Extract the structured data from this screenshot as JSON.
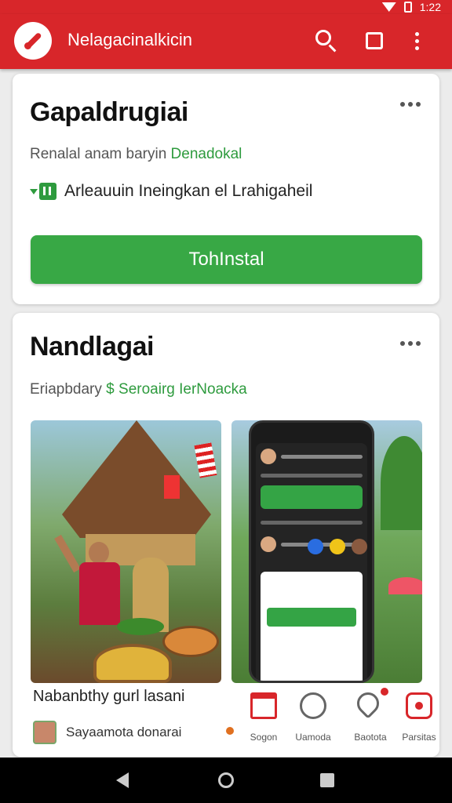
{
  "status_bar": {
    "time": "1:22"
  },
  "app_bar": {
    "title": "Nelagacinalkicin",
    "icons": [
      "app-logo",
      "search-icon",
      "square-icon",
      "more-vert-icon"
    ]
  },
  "card1": {
    "title": "Gapaldrugiai",
    "subtitle_plain": "Renalal anam baryin ",
    "subtitle_accent": "Denadokal",
    "info_text": "Arleauuin Ineingkan el Lrahigaheil",
    "install_label": "TohInstal"
  },
  "card2": {
    "title": "Nandlagai",
    "subtitle_plain": "Eriapbdary ",
    "subtitle_accent": "$ Seroairg IerNoacka",
    "caption": "Nabanbthy gurl lasani",
    "author_name": "Sayaamota donarai"
  },
  "tabs": [
    {
      "label": "Sogon",
      "icon": "store-icon"
    },
    {
      "label": "Uamoda",
      "icon": "clock-icon"
    },
    {
      "label": "Baotota",
      "icon": "tag-icon"
    },
    {
      "label": "Parsitas",
      "icon": "profile-icon"
    }
  ],
  "colors": {
    "primary": "#d8262a",
    "accent": "#2e9b3e",
    "button": "#38a845"
  }
}
